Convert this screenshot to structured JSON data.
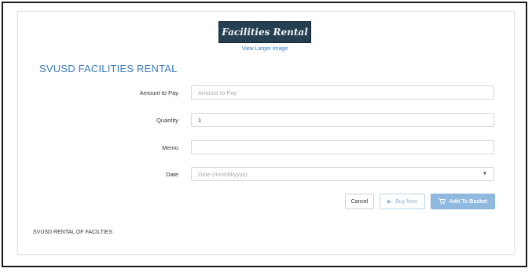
{
  "product": {
    "banner_text": "Facilities Rental",
    "view_larger_label": "View Larger Image",
    "title": "SVUSD FACILITIES RENTAL",
    "description": "SVUSD RENTAL OF FACILTIES"
  },
  "form": {
    "amount": {
      "label": "Amount to Pay",
      "placeholder": "Amount to Pay",
      "value": ""
    },
    "quantity": {
      "label": "Quantity",
      "value": "1"
    },
    "memo": {
      "label": "Memo",
      "value": ""
    },
    "date": {
      "label": "Date",
      "placeholder": "Date (mm/dd/yyyy)"
    }
  },
  "buttons": {
    "cancel": "Cancel",
    "buy_now": "Buy Now",
    "add_to_basket": "Add To Basket"
  },
  "colors": {
    "accent": "#3a7bbf",
    "banner_bg": "#1f3a4d",
    "basket_button": "#8fb9de"
  }
}
